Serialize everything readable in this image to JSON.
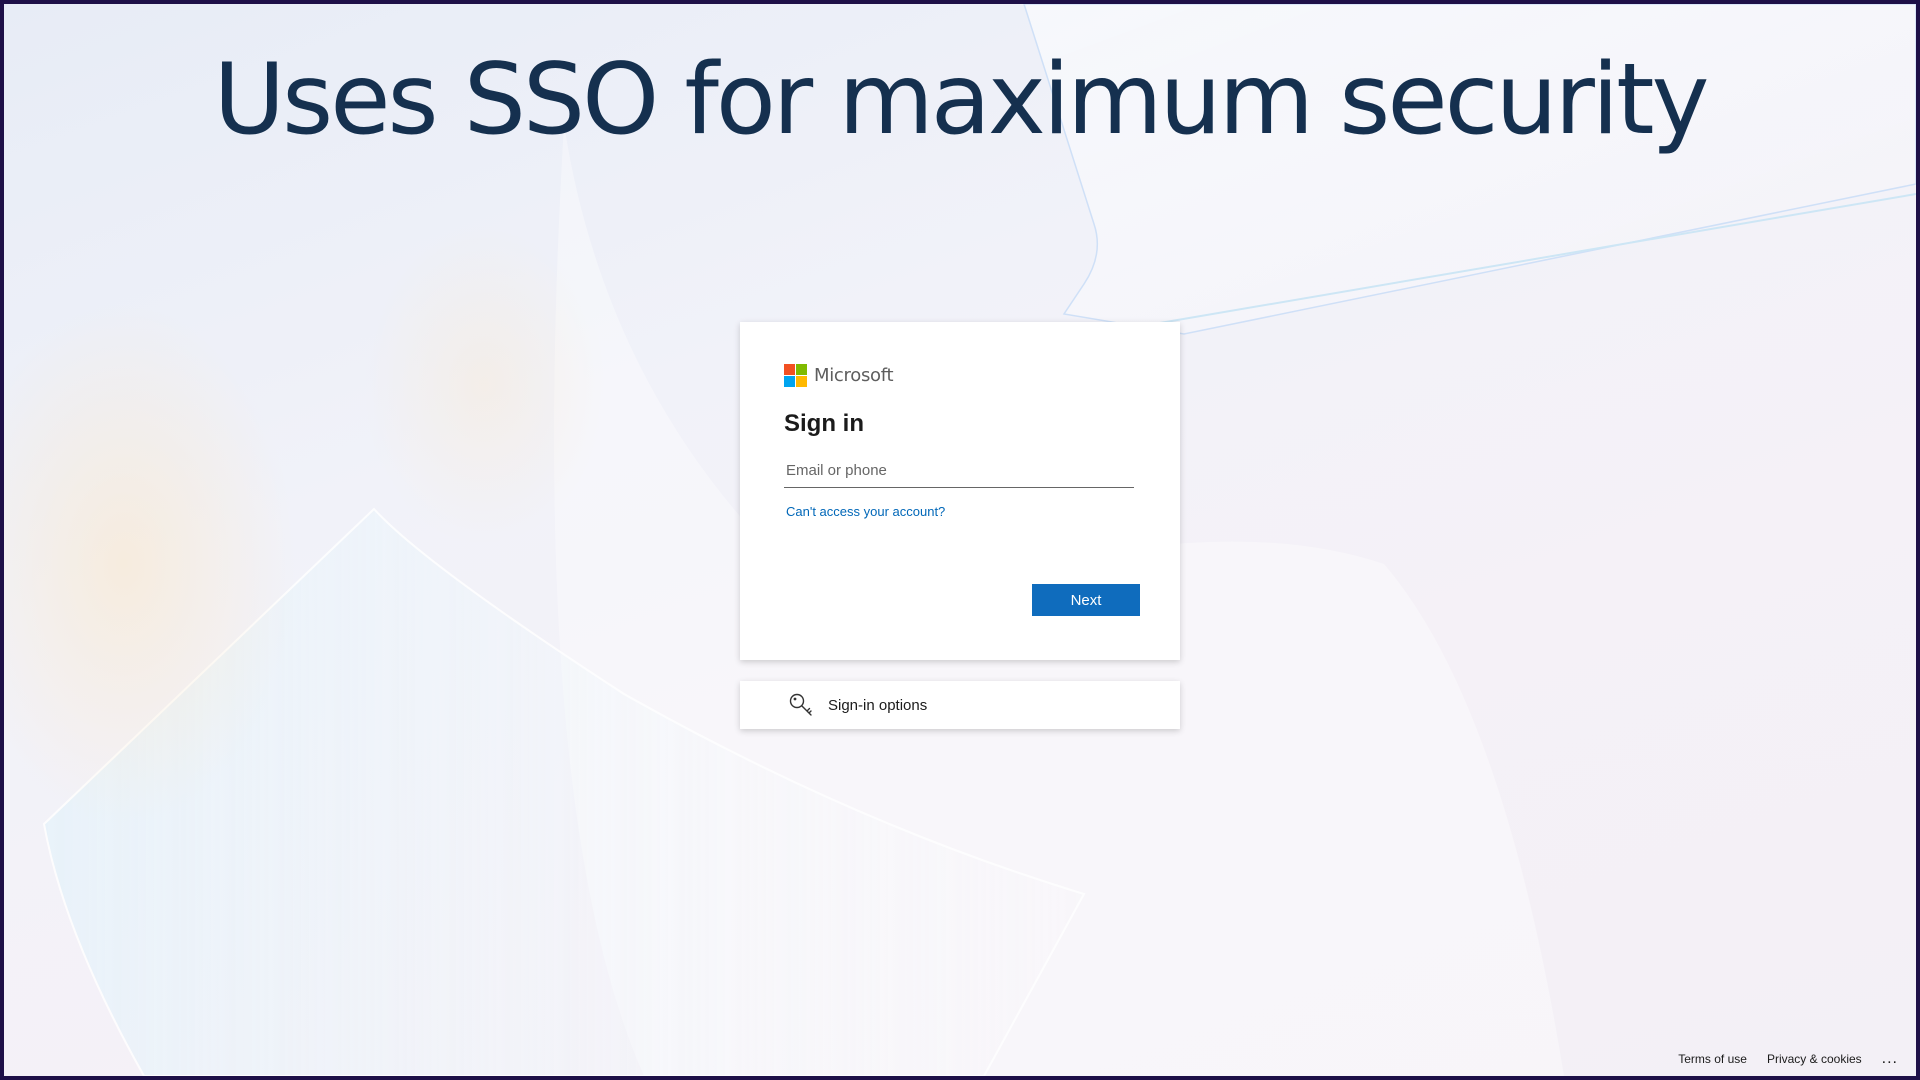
{
  "slide": {
    "headline": "Uses SSO for maximum security"
  },
  "brand": {
    "name": "Microsoft",
    "logo_colors": [
      "#f25022",
      "#7fba00",
      "#00a4ef",
      "#ffb900"
    ]
  },
  "signin": {
    "title": "Sign in",
    "email_placeholder": "Email or phone",
    "email_value": "",
    "help_link": "Can't access your account?",
    "next_label": "Next",
    "accent_color": "#0f6cbd"
  },
  "options": {
    "icon": "key-icon",
    "label": "Sign-in options"
  },
  "footer": {
    "terms": "Terms of use",
    "privacy": "Privacy & cookies",
    "more": "..."
  }
}
